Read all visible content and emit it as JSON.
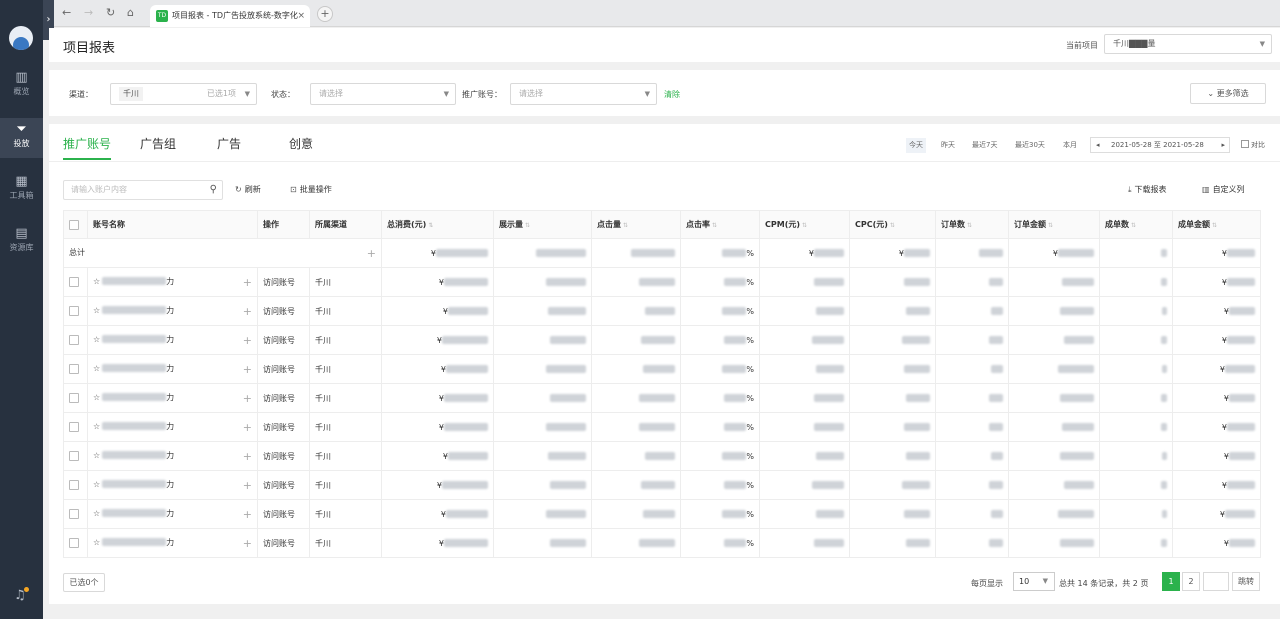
{
  "browser": {
    "tab_title": "项目报表 - TD广告投放系统-数字化",
    "favicon": "TD",
    "close": "×",
    "new_tab": "+"
  },
  "sidebar": {
    "items": [
      {
        "label": "概览",
        "icon": "bar-chart-icon"
      },
      {
        "label": "投放",
        "icon": "filter-icon"
      },
      {
        "label": "工具箱",
        "icon": "grid-icon"
      },
      {
        "label": "资源库",
        "icon": "briefcase-icon"
      }
    ]
  },
  "header": {
    "title": "项目报表",
    "project_label": "当前项目",
    "project_value": "千川▇▇▇量"
  },
  "filters": {
    "channel_label": "渠道：",
    "channel_chip": "千川",
    "channel_selected": "已选1项",
    "status_label": "状态：",
    "status_placeholder": "请选择",
    "account_label": "推广账号：",
    "account_placeholder": "请选择",
    "clear": "清除",
    "more": "更多筛选"
  },
  "tabs": [
    "推广账号",
    "广告组",
    "广告",
    "创意"
  ],
  "date_quick": [
    "今天",
    "昨天",
    "最近7天",
    "最近30天",
    "本月"
  ],
  "date_range": "2021-05-28 至 2021-05-28",
  "compare_label": "对比",
  "toolbar": {
    "search_placeholder": "请输入账户内容",
    "refresh": "刷新",
    "batch": "批量操作",
    "download": "下载报表",
    "customize": "自定义列"
  },
  "table": {
    "columns": [
      "账号名称",
      "操作",
      "所属渠道",
      "总消费(元)",
      "展示量",
      "点击量",
      "点击率",
      "CPM(元)",
      "CPC(元)",
      "订单数",
      "订单金额",
      "成单数",
      "成单金额"
    ],
    "total_label": "总计",
    "row_action": "访问账号",
    "row_channel": "千川",
    "name_suffix": "力",
    "currency": "¥",
    "percent": "%",
    "row_count": 10
  },
  "footer": {
    "selected": "已选0个",
    "per_page_label": "每页显示",
    "per_page": "10",
    "summary": "总共 14 条记录，共 2 页",
    "pages": [
      "1",
      "2"
    ],
    "jump": "跳转"
  }
}
